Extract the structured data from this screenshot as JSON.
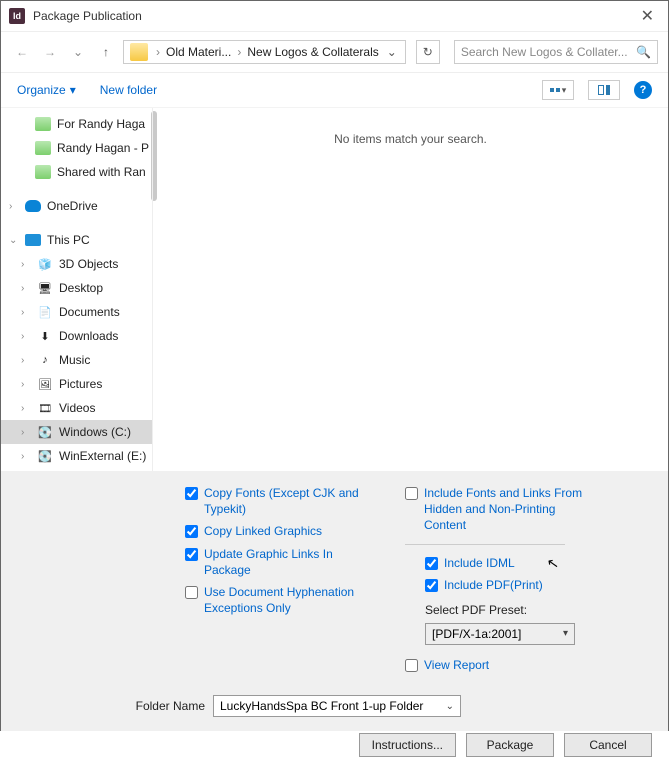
{
  "titlebar": {
    "app_badge": "Id",
    "title": "Package Publication",
    "close": "✕"
  },
  "nav": {
    "back": "←",
    "forward": "→",
    "up": "↑",
    "refresh": "↻",
    "breadcrumb": {
      "sep1": "›",
      "crumb1": "Old Materi...",
      "sep2": "›",
      "crumb2": "New Logos & Collaterals",
      "dd": "⌄"
    },
    "search_placeholder": "Search New Logos & Collater...",
    "search_icon": "🔍"
  },
  "toolbar": {
    "organize": "Organize",
    "organize_dd": "▾",
    "new_folder": "New folder",
    "help": "?"
  },
  "tree": {
    "items": [
      {
        "icon": "share",
        "label": "For Randy Haga"
      },
      {
        "icon": "share",
        "label": "Randy Hagan - P"
      },
      {
        "icon": "share",
        "label": "Shared with Ran"
      }
    ],
    "onedrive": "OneDrive",
    "thispc": "This PC",
    "pc_items": [
      {
        "glyph": "🧊",
        "label": "3D Objects"
      },
      {
        "glyph": "🖥",
        "label": "Desktop"
      },
      {
        "glyph": "📄",
        "label": "Documents"
      },
      {
        "glyph": "⬇",
        "label": "Downloads"
      },
      {
        "glyph": "♪",
        "label": "Music"
      },
      {
        "glyph": "🖼",
        "label": "Pictures"
      },
      {
        "glyph": "🎞",
        "label": "Videos"
      },
      {
        "glyph": "💽",
        "label": "Windows (C:)",
        "selected": true
      },
      {
        "glyph": "💽",
        "label": "WinExternal (E:)"
      }
    ],
    "chev_r": "›",
    "chev_d": "⌄"
  },
  "content": {
    "empty_msg": "No items match your search."
  },
  "options": {
    "left": [
      {
        "label": "Copy Fonts (Except CJK and Typekit)",
        "checked": true
      },
      {
        "label": "Copy Linked Graphics",
        "checked": true
      },
      {
        "label": "Update Graphic Links In Package",
        "checked": true
      },
      {
        "label": "Use Document Hyphenation Exceptions Only",
        "checked": false
      }
    ],
    "right_top": {
      "label": "Include Fonts and Links From Hidden and Non-Printing Content",
      "checked": false
    },
    "include_idml": {
      "label": "Include IDML",
      "checked": true
    },
    "include_pdf": {
      "label": "Include PDF(Print)",
      "checked": true
    },
    "preset_label": "Select PDF Preset:",
    "preset_value": "[PDF/X-1a:2001]",
    "view_report": {
      "label": "View Report",
      "checked": false
    }
  },
  "folder": {
    "label": "Folder Name",
    "value": "LuckyHandsSpa BC Front 1-up Folder"
  },
  "buttons": {
    "instructions": "Instructions...",
    "package": "Package",
    "cancel": "Cancel"
  },
  "cursor": "↖"
}
